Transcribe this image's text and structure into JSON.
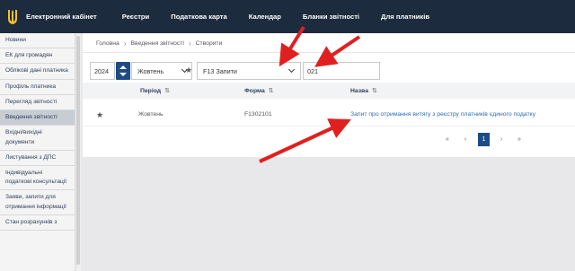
{
  "nav": {
    "items": [
      "Електронний кабінет",
      "Реєстри",
      "Податкова карта",
      "Календар",
      "Бланки звітності",
      "Для платників"
    ]
  },
  "sidebar": {
    "items": [
      {
        "label": "Новини"
      },
      {
        "label": "ЕК для громадян"
      },
      {
        "label": "Облікові дані платника"
      },
      {
        "label": "Профіль платника"
      },
      {
        "label": "Перегляд звітності"
      },
      {
        "label": "Введення звітності",
        "active": true
      },
      {
        "label": "Вхідні/вихідні документи"
      },
      {
        "label": "Листування з ДПС"
      },
      {
        "label": "Індивідуальні податкові консультації"
      },
      {
        "label": "Заяви, запити для отримання інформації"
      },
      {
        "label": "Стан розрахунків з"
      }
    ]
  },
  "breadcrumb": [
    "Головна",
    "Введення звітності",
    "Створити"
  ],
  "filters": {
    "year": "2024",
    "month": "Жовтень",
    "form_type": "F13 Запити",
    "code": "021"
  },
  "table": {
    "columns": [
      "Період",
      "Форма",
      "Назва"
    ],
    "rows": [
      {
        "period": "Жовтень",
        "form": "F1302101",
        "title": "Запит про отримання витягу з реєстру платників єдиного податку"
      }
    ]
  },
  "pagination": {
    "first": "«",
    "prev": "‹",
    "current": "1",
    "next": "›",
    "last": "»"
  },
  "colors": {
    "topbar": "#1d2b3e",
    "accent": "#1e4b85",
    "link": "#2d6bb5",
    "arrow": "#e02020",
    "logo": "#f2c12e"
  },
  "icons": {
    "logo": "trident-icon",
    "favorite": "star-icon",
    "dropdown": "chevron-down-icon",
    "sort": "sort-icon"
  }
}
